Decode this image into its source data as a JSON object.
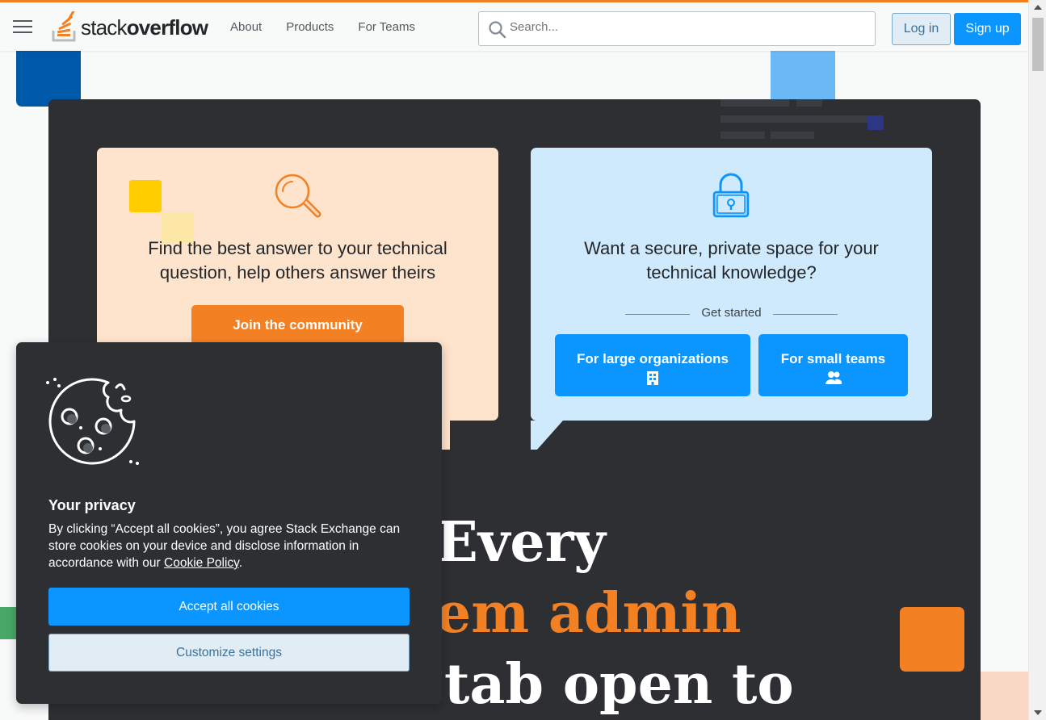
{
  "header": {
    "logo_light": "stack",
    "logo_bold": "overflow",
    "nav": [
      "About",
      "Products",
      "For Teams"
    ],
    "search_placeholder": "Search...",
    "login_label": "Log in",
    "signup_label": "Sign up"
  },
  "hero": {
    "community_card": {
      "text": "Find the best answer to your technical question, help others answer theirs",
      "button": "Join the community"
    },
    "teams_card": {
      "text": "Want a secure, private space for your technical knowledge?",
      "divider_label": "Get started",
      "btn_large": "For large organizations",
      "btn_small": "For small teams"
    },
    "headline": {
      "line1": "Every",
      "line2": "em admin",
      "line3": "tab open to"
    }
  },
  "privacy": {
    "title": "Your privacy",
    "body_before_link": "By clicking “Accept all cookies”, you agree Stack Exchange can store cookies on your device and disclose information in accordance with our ",
    "link": "Cookie Policy",
    "body_after_link": ".",
    "accept_label": "Accept all cookies",
    "customize_label": "Customize settings"
  },
  "colors": {
    "brand_orange": "#f48024",
    "primary_blue": "#0a95ff",
    "hero_dark": "#2d2f33",
    "card_orange": "#fee3cd",
    "card_blue": "#cfe9fd"
  }
}
